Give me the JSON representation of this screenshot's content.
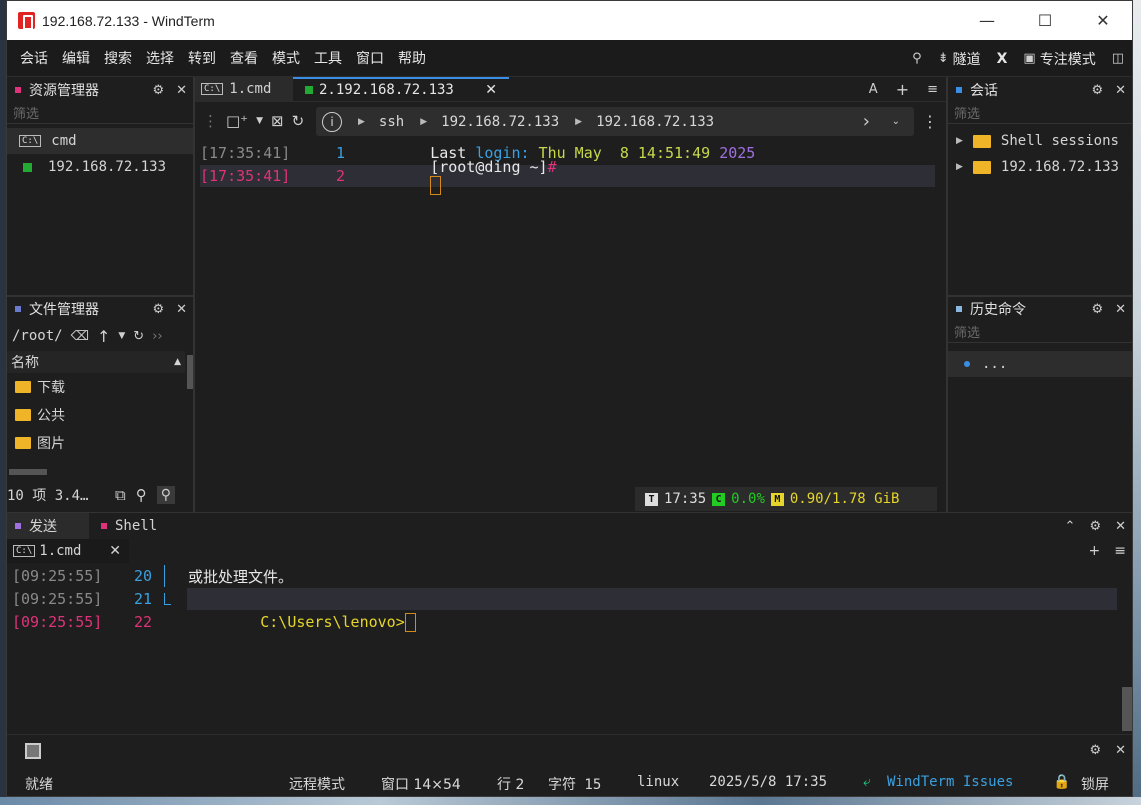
{
  "window": {
    "title": "192.168.72.133 - WindTerm",
    "minimize": "—",
    "maximize": "☐",
    "close": "✕"
  },
  "menu": {
    "items": [
      "会话",
      "编辑",
      "搜索",
      "选择",
      "转到",
      "查看",
      "模式",
      "工具",
      "窗口",
      "帮助"
    ],
    "tunnel": "隧道",
    "x_label": "X",
    "focus_mode": "专注模式"
  },
  "resource_manager": {
    "title": "资源管理器",
    "filter_placeholder": "筛选",
    "items": [
      {
        "label": "cmd",
        "icon": "terminal-icon"
      },
      {
        "label": "192.168.72.133",
        "icon": "green-square-icon",
        "color": "#22aa33"
      }
    ]
  },
  "file_manager": {
    "title": "文件管理器",
    "path": "/root/",
    "column_name": "名称",
    "items": [
      "下载",
      "公共",
      "图片"
    ],
    "footer": "10 项 3.4…"
  },
  "tabs": [
    {
      "label": "1.cmd",
      "icon": "terminal-icon"
    },
    {
      "label": "2.192.168.72.133",
      "icon": "green-square-icon"
    }
  ],
  "tabbar_right": {
    "font": "A",
    "add": "+",
    "more": "≡"
  },
  "address": {
    "segments": [
      "ssh",
      "192.168.72.133",
      "192.168.72.133"
    ]
  },
  "terminal": {
    "lines": [
      {
        "time": "[17:35:41]",
        "num": "1",
        "parts": {
          "a": "Last ",
          "b": "login:",
          "c": " Thu May  8 14:51:49 ",
          "d": "2025"
        }
      },
      {
        "time": "[17:35:41]",
        "num": "2",
        "prompt": "[root@ding ~]",
        "hash": "#"
      }
    ]
  },
  "term_status": {
    "time": "17:35",
    "cpu": "0.0%",
    "mem": "0.90/1.78 GiB",
    "t_badge": "T",
    "c_badge": "C",
    "m_badge": "M"
  },
  "sessions": {
    "title": "会话",
    "filter_placeholder": "筛选",
    "items": [
      "Shell sessions",
      "192.168.72.133"
    ]
  },
  "history": {
    "title": "历史命令",
    "filter_placeholder": "筛选",
    "items": [
      "..."
    ]
  },
  "bottom": {
    "tabs": [
      "发送",
      "Shell"
    ],
    "subtab": "1.cmd",
    "lines": [
      {
        "time": "[09:25:55]",
        "num": "20",
        "text": "或批处理文件。"
      },
      {
        "time": "[09:25:55]",
        "num": "21",
        "text": ""
      },
      {
        "time": "[09:25:55]",
        "num": "22",
        "text": "C:\\Users\\lenovo>"
      }
    ]
  },
  "statusbar": {
    "ready": "就绪",
    "remote_mode": "远程模式",
    "window_size": "窗口 14×54",
    "row": "行 2",
    "char": "字符 15",
    "os": "linux",
    "datetime": "2025/5/8 17:35",
    "issues": "WindTerm Issues",
    "lock": "锁屏"
  },
  "colors": {
    "accent": "#3a8ee6",
    "pink": "#e0327a",
    "green": "#9bd32a",
    "purple": "#a070e0",
    "yellow": "#e6d52a"
  }
}
